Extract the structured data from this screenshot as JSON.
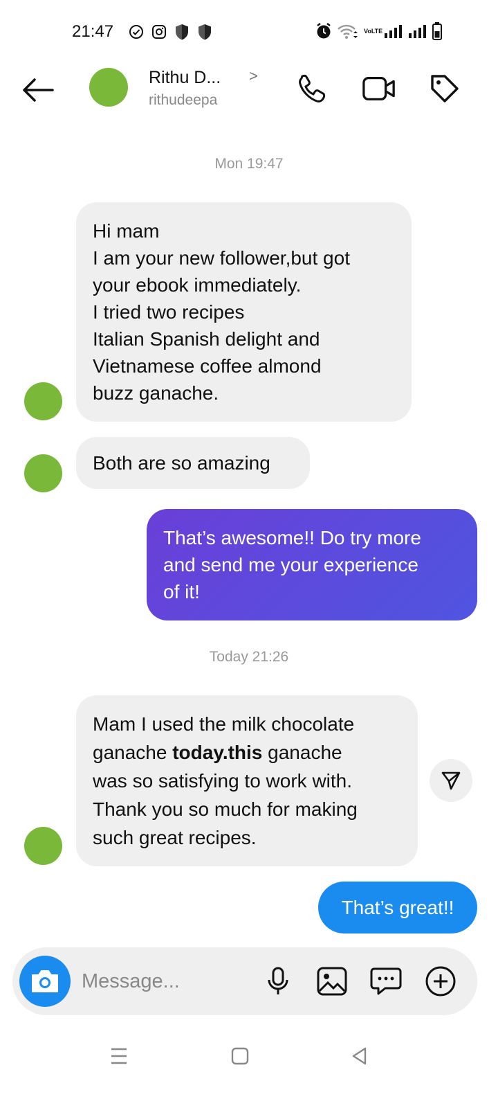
{
  "status_bar": {
    "time": "21:47",
    "network_label": "VoLTE",
    "icons_left": [
      "check-circle-icon",
      "instagram-icon",
      "shield-icon",
      "shield-icon"
    ],
    "icons_right": [
      "alarm-icon",
      "wifi-icon",
      "volte-badge",
      "signal-icon",
      "signal-icon",
      "battery-icon"
    ]
  },
  "header": {
    "contact_name": "Rithu D...",
    "username": "rithudeepa",
    "chevron": ">",
    "icons": [
      "back-arrow-icon",
      "phone-icon",
      "video-camera-icon",
      "tag-icon"
    ]
  },
  "conversation": {
    "timestamps": [
      "Mon 19:47",
      "Today 21:26"
    ],
    "messages": [
      {
        "from": "them",
        "lines": [
          "Hi mam",
          "I am your new follower,but got",
          "your ebook immediately.",
          "I tried two recipes",
          "Italian Spanish delight and",
          "Vietnamese coffee almond",
          "buzz ganache."
        ]
      },
      {
        "from": "them",
        "lines": [
          "Both are so amazing"
        ]
      },
      {
        "from": "me",
        "lines": [
          "That’s awesome!! Do try more",
          "and send me your experience",
          "of it!"
        ]
      },
      {
        "from": "them",
        "line1": "Mam I used the milk chocolate",
        "line2_pre": "ganache ",
        "line2_bold": "today.this",
        "line2_post": " ganache",
        "line3": "was so satisfying to work with.",
        "line4": "Thank you so much for making",
        "line5": "such great recipes."
      },
      {
        "from": "me",
        "lines": [
          "That’s great!!"
        ]
      }
    ]
  },
  "composer": {
    "placeholder": "Message...",
    "icons": [
      "camera-icon",
      "microphone-icon",
      "gallery-icon",
      "sticker-chat-icon",
      "plus-circle-icon"
    ]
  },
  "nav_bar": {
    "icons": [
      "menu-icon",
      "home-square-icon",
      "back-triangle-icon"
    ]
  },
  "colors": {
    "accent_blue": "#1a8cf0",
    "purple_bubble": "#5a4ae0",
    "incoming_bubble": "#efefef",
    "avatar_green": "#7ab83a"
  }
}
